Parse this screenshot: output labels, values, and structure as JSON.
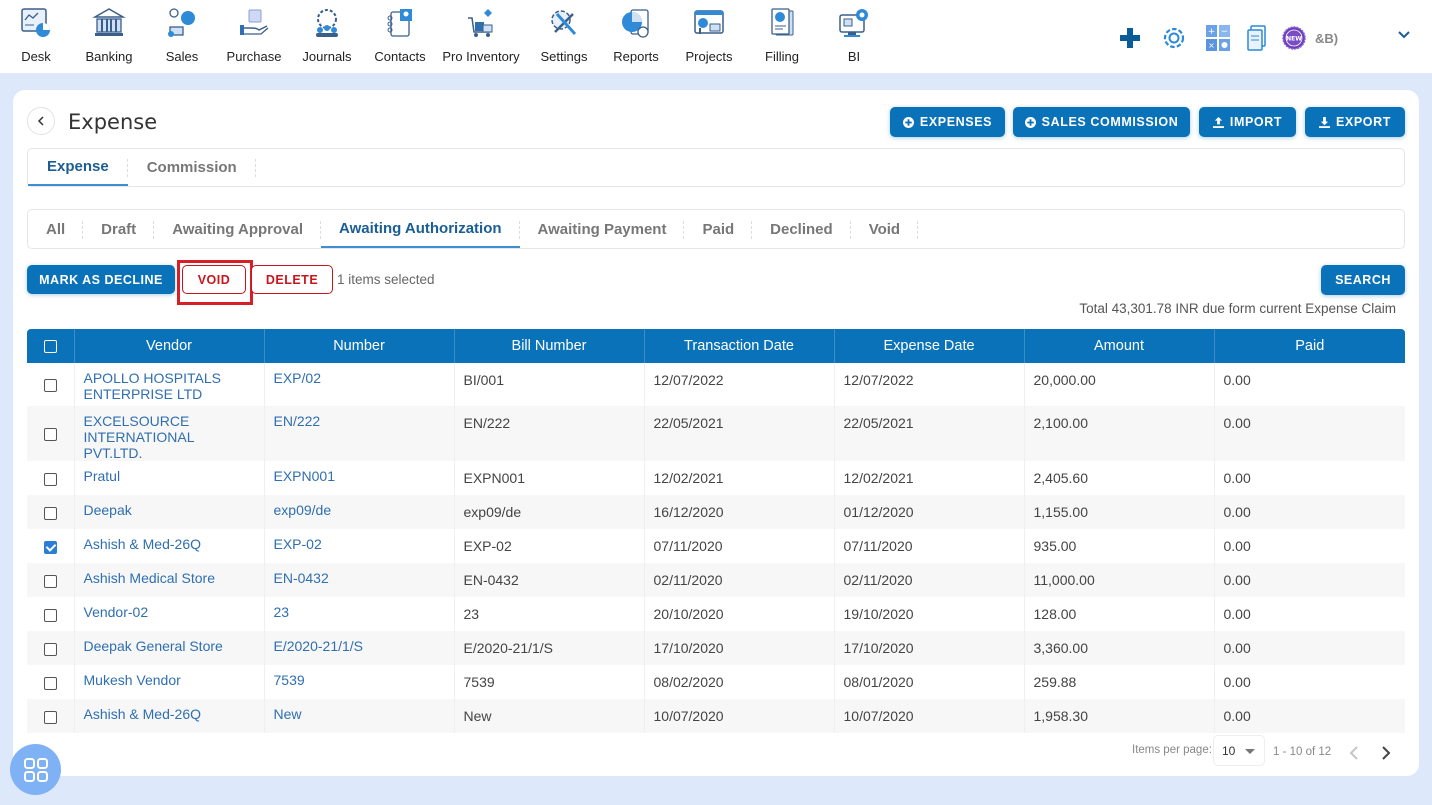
{
  "nav": {
    "items": [
      {
        "label": "Desk",
        "icon": "desk-icon"
      },
      {
        "label": "Banking",
        "icon": "bank-icon"
      },
      {
        "label": "Sales",
        "icon": "sales-icon"
      },
      {
        "label": "Purchase",
        "icon": "purchase-icon"
      },
      {
        "label": "Journals",
        "icon": "journals-icon"
      },
      {
        "label": "Contacts",
        "icon": "contacts-icon"
      },
      {
        "label": "Pro Inventory",
        "icon": "inventory-icon"
      },
      {
        "label": "Settings",
        "icon": "settings-icon"
      },
      {
        "label": "Reports",
        "icon": "reports-icon"
      },
      {
        "label": "Projects",
        "icon": "projects-icon"
      },
      {
        "label": "Filling",
        "icon": "filling-icon"
      },
      {
        "label": "BI",
        "icon": "bi-icon"
      }
    ],
    "right_tools": [
      "plus-icon",
      "gear-icon",
      "calculator-icon",
      "documents-icon",
      "new-badge-icon"
    ],
    "new_badge_text": "NEW",
    "company_text": "&B)"
  },
  "page": {
    "title": "Expense",
    "actions": [
      {
        "label": "EXPENSES",
        "icon": "plus-circle-icon"
      },
      {
        "label": "SALES COMMISSION",
        "icon": "plus-circle-icon"
      },
      {
        "label": "IMPORT",
        "icon": "upload-icon"
      },
      {
        "label": "EXPORT",
        "icon": "download-icon"
      }
    ],
    "subtabs": [
      {
        "label": "Expense",
        "active": true
      },
      {
        "label": "Commission",
        "active": false
      }
    ],
    "status_tabs": [
      {
        "label": "All",
        "active": false
      },
      {
        "label": "Draft",
        "active": false
      },
      {
        "label": "Awaiting Approval",
        "active": false
      },
      {
        "label": "Awaiting Authorization",
        "active": true
      },
      {
        "label": "Awaiting Payment",
        "active": false
      },
      {
        "label": "Paid",
        "active": false
      },
      {
        "label": "Declined",
        "active": false
      },
      {
        "label": "Void",
        "active": false
      }
    ],
    "bulk": {
      "mark_decline": "MARK AS DECLINE",
      "void": "VOID",
      "delete": "DELETE",
      "selected_text": "1 items selected"
    },
    "search_label": "SEARCH",
    "total_text": "Total 43,301.78 INR due form current Expense Claim"
  },
  "table": {
    "columns": [
      "Vendor",
      "Number",
      "Bill Number",
      "Transaction Date",
      "Expense Date",
      "Amount",
      "Paid"
    ],
    "rows": [
      {
        "checked": false,
        "vendor": "APOLLO HOSPITALS ENTERPRISE LTD",
        "number": "EXP/02",
        "bill": "BI/001",
        "txn_date": "12/07/2022",
        "exp_date": "12/07/2022",
        "amount": "20,000.00",
        "paid": "0.00"
      },
      {
        "checked": false,
        "vendor": "EXCELSOURCE INTERNATIONAL PVT.LTD.",
        "number": "EN/222",
        "bill": "EN/222",
        "txn_date": "22/05/2021",
        "exp_date": "22/05/2021",
        "amount": "2,100.00",
        "paid": "0.00"
      },
      {
        "checked": false,
        "vendor": "Pratul",
        "number": "EXPN001",
        "bill": "EXPN001",
        "txn_date": "12/02/2021",
        "exp_date": "12/02/2021",
        "amount": "2,405.60",
        "paid": "0.00"
      },
      {
        "checked": false,
        "vendor": "Deepak",
        "number": "exp09/de",
        "bill": "exp09/de",
        "txn_date": "16/12/2020",
        "exp_date": "01/12/2020",
        "amount": "1,155.00",
        "paid": "0.00"
      },
      {
        "checked": true,
        "vendor": "Ashish & Med-26Q",
        "number": "EXP-02",
        "bill": "EXP-02",
        "txn_date": "07/11/2020",
        "exp_date": "07/11/2020",
        "amount": "935.00",
        "paid": "0.00"
      },
      {
        "checked": false,
        "vendor": "Ashish Medical Store",
        "number": "EN-0432",
        "bill": "EN-0432",
        "txn_date": "02/11/2020",
        "exp_date": "02/11/2020",
        "amount": "11,000.00",
        "paid": "0.00"
      },
      {
        "checked": false,
        "vendor": "Vendor-02",
        "number": "23",
        "bill": "23",
        "txn_date": "20/10/2020",
        "exp_date": "19/10/2020",
        "amount": "128.00",
        "paid": "0.00"
      },
      {
        "checked": false,
        "vendor": "Deepak General Store",
        "number": "E/2020-21/1/S",
        "bill": "E/2020-21/1/S",
        "txn_date": "17/10/2020",
        "exp_date": "17/10/2020",
        "amount": "3,360.00",
        "paid": "0.00"
      },
      {
        "checked": false,
        "vendor": "Mukesh Vendor",
        "number": "7539",
        "bill": "7539",
        "txn_date": "08/02/2020",
        "exp_date": "08/01/2020",
        "amount": "259.88",
        "paid": "0.00"
      },
      {
        "checked": false,
        "vendor": "Ashish & Med-26Q",
        "number": "New",
        "bill": "New",
        "txn_date": "10/07/2020",
        "exp_date": "10/07/2020",
        "amount": "1,958.30",
        "paid": "0.00"
      }
    ]
  },
  "pagination": {
    "items_per_page_label": "Items per page:",
    "items_per_page": "10",
    "range": "1 - 10 of 12"
  },
  "colors": {
    "primary": "#0a72b8",
    "danger": "#c8161d",
    "link": "#2f6fb0",
    "background": "#dde8fb"
  }
}
